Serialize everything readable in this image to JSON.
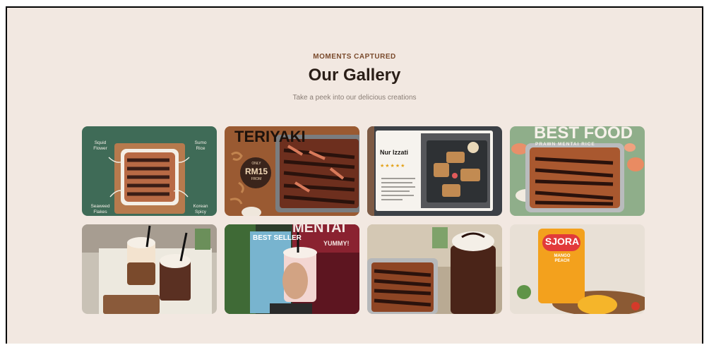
{
  "gallery": {
    "eyebrow": "MOMENTS CAPTURED",
    "title": "Our Gallery",
    "subtitle": "Take a peek into our delicious creations"
  },
  "tiles": [
    {
      "name": "gallery-image-1",
      "labels": [
        "Squid\nFlower",
        "Sumo\nRice",
        "Seaweed\nFlakes",
        "Korean\nSpicy"
      ]
    },
    {
      "name": "gallery-image-2",
      "headline": "TERIYAKI",
      "badge_top": "ONLY",
      "badge_price": "RM15",
      "badge_bottom": "FROM"
    },
    {
      "name": "gallery-image-3",
      "reviewer": "Nur Izzati",
      "stars": "★★★★★"
    },
    {
      "name": "gallery-image-4",
      "headline": "BEST FOOD",
      "sub": "PRAWN MENTAI RICE"
    },
    {
      "name": "gallery-image-5"
    },
    {
      "name": "gallery-image-6",
      "headline": "MENTAI",
      "sub": "YUMMY!",
      "badge": "BEST SELLER"
    },
    {
      "name": "gallery-image-7"
    },
    {
      "name": "gallery-image-8",
      "brand": "SJORA",
      "flavor": "MANGO\nPEACH"
    }
  ],
  "colors": {
    "background": "#f2e8e1",
    "heading": "#2a1e17",
    "eyebrow": "#7a4a2c",
    "muted": "#8a7e76"
  }
}
